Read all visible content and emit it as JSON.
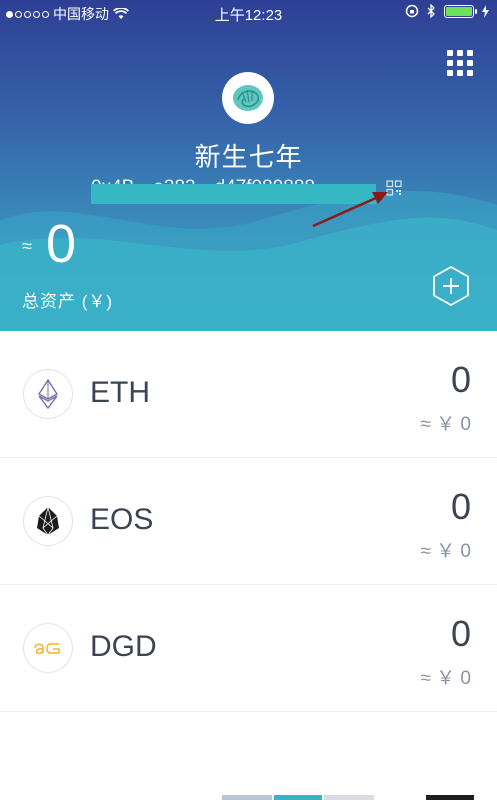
{
  "status_bar": {
    "carrier": "中国移动",
    "time": "上午12:23"
  },
  "wallet": {
    "name": "新生七年",
    "address": "0x4B…e383…d47f089888",
    "total_approx_symbol": "≈",
    "total_value": "0",
    "total_label": "总资产 (￥)"
  },
  "assets": [
    {
      "symbol": "ETH",
      "amount": "0",
      "fiat": "≈ ￥ 0",
      "icon": "eth-icon"
    },
    {
      "symbol": "EOS",
      "amount": "0",
      "fiat": "≈ ￥ 0",
      "icon": "eos-icon"
    },
    {
      "symbol": "DGD",
      "amount": "0",
      "fiat": "≈ ￥ 0",
      "icon": "dgd-icon"
    }
  ],
  "colors": {
    "header_top": "#2e3f95",
    "header_bottom": "#3bb3c9",
    "battery": "#6fe25c",
    "arrow": "#8b1a1a",
    "dgd": "#f0b429"
  }
}
